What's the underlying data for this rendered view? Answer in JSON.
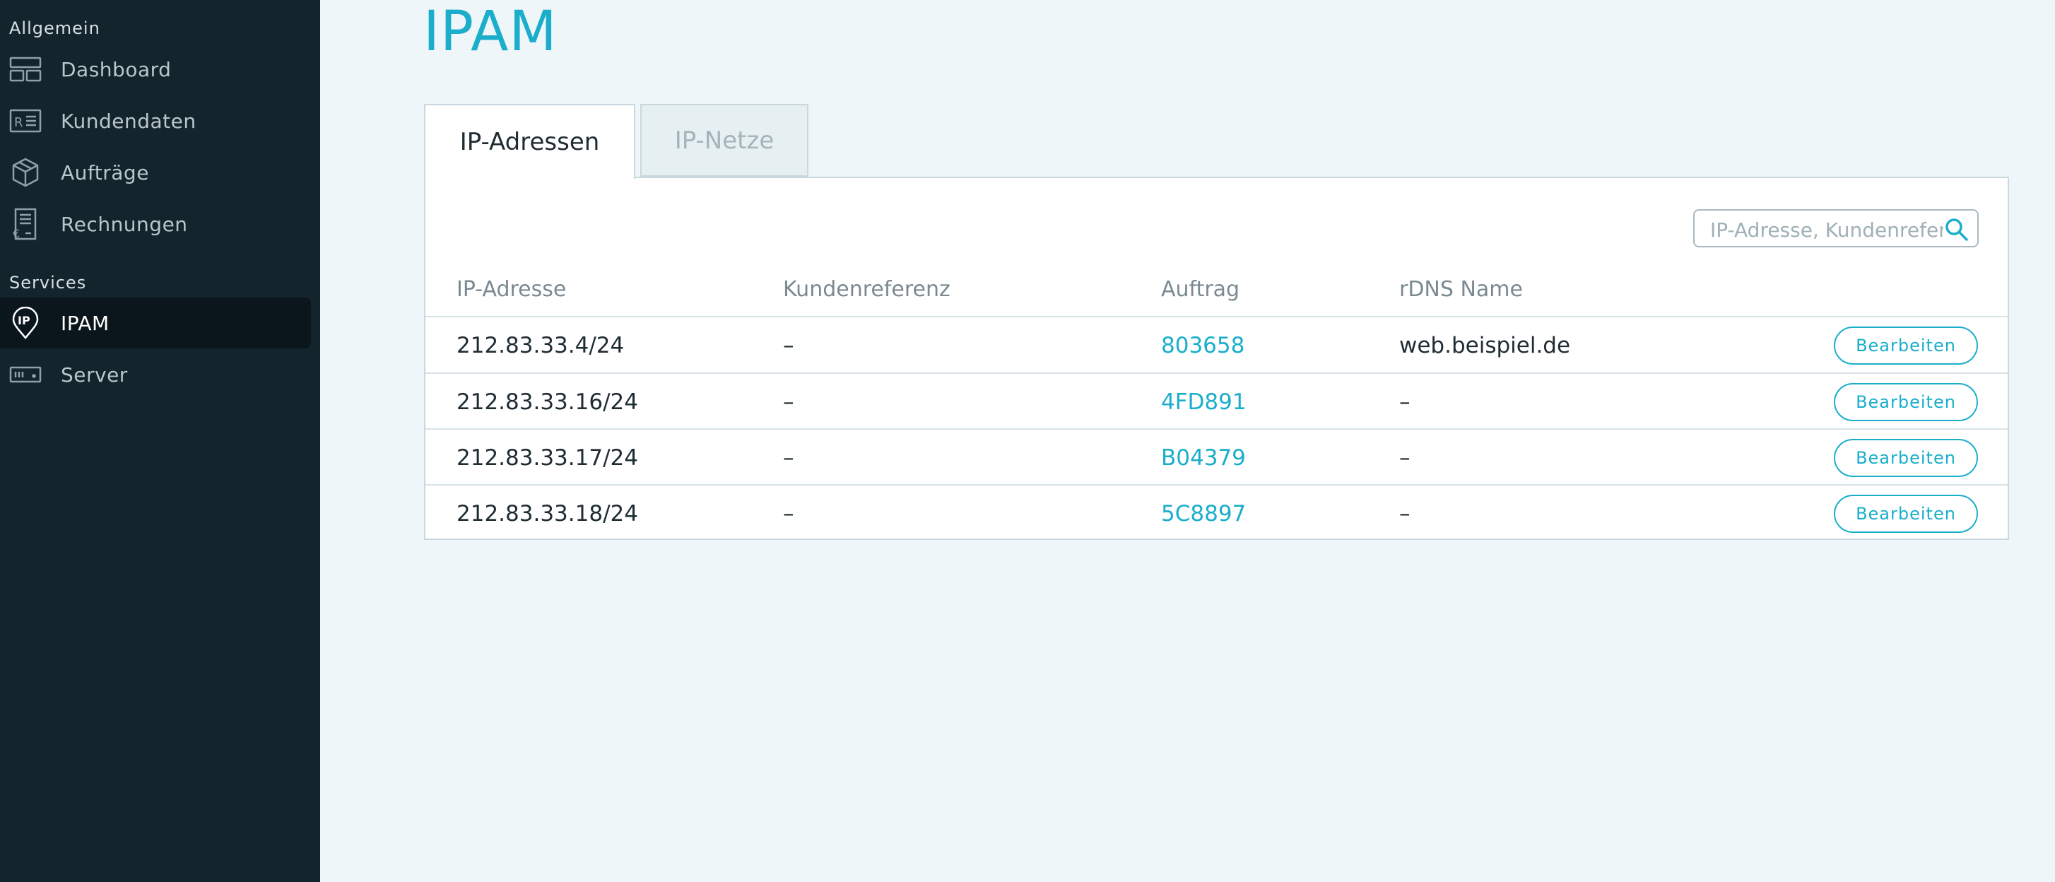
{
  "sidebar": {
    "sections": [
      {
        "label": "Allgemein",
        "items": [
          {
            "label": "Dashboard",
            "icon": "dashboard-icon"
          },
          {
            "label": "Kundendaten",
            "icon": "id-card-icon"
          },
          {
            "label": "Aufträge",
            "icon": "box-icon"
          },
          {
            "label": "Rechnungen",
            "icon": "invoice-icon"
          }
        ]
      },
      {
        "label": "Services",
        "items": [
          {
            "label": "IPAM",
            "icon": "ip-pin-icon",
            "active": true
          },
          {
            "label": "Server",
            "icon": "server-icon"
          }
        ]
      }
    ]
  },
  "page": {
    "title": "IPAM",
    "tabs": [
      {
        "label": "IP-Adressen",
        "active": true
      },
      {
        "label": "IP-Netze",
        "active": false
      }
    ]
  },
  "search": {
    "placeholder": "IP-Adresse, Kundenreferenz"
  },
  "table": {
    "headers": [
      "IP-Adresse",
      "Kundenreferenz",
      "Auftrag",
      "rDNS Name"
    ],
    "rows": [
      {
        "ip": "212.83.33.4/24",
        "kundenreferenz": "–",
        "auftrag": "803658",
        "rdns": "web.beispiel.de",
        "action": "Bearbeiten"
      },
      {
        "ip": "212.83.33.16/24",
        "kundenreferenz": "–",
        "auftrag": "4FD891",
        "rdns": "–",
        "action": "Bearbeiten"
      },
      {
        "ip": "212.83.33.17/24",
        "kundenreferenz": "–",
        "auftrag": "B04379",
        "rdns": "–",
        "action": "Bearbeiten"
      },
      {
        "ip": "212.83.33.18/24",
        "kundenreferenz": "–",
        "auftrag": "5C8897",
        "rdns": "–",
        "action": "Bearbeiten"
      }
    ]
  },
  "colors": {
    "accent": "#1aaecb",
    "sidebar_bg": "#13242c",
    "page_bg": "#eef6f9"
  }
}
